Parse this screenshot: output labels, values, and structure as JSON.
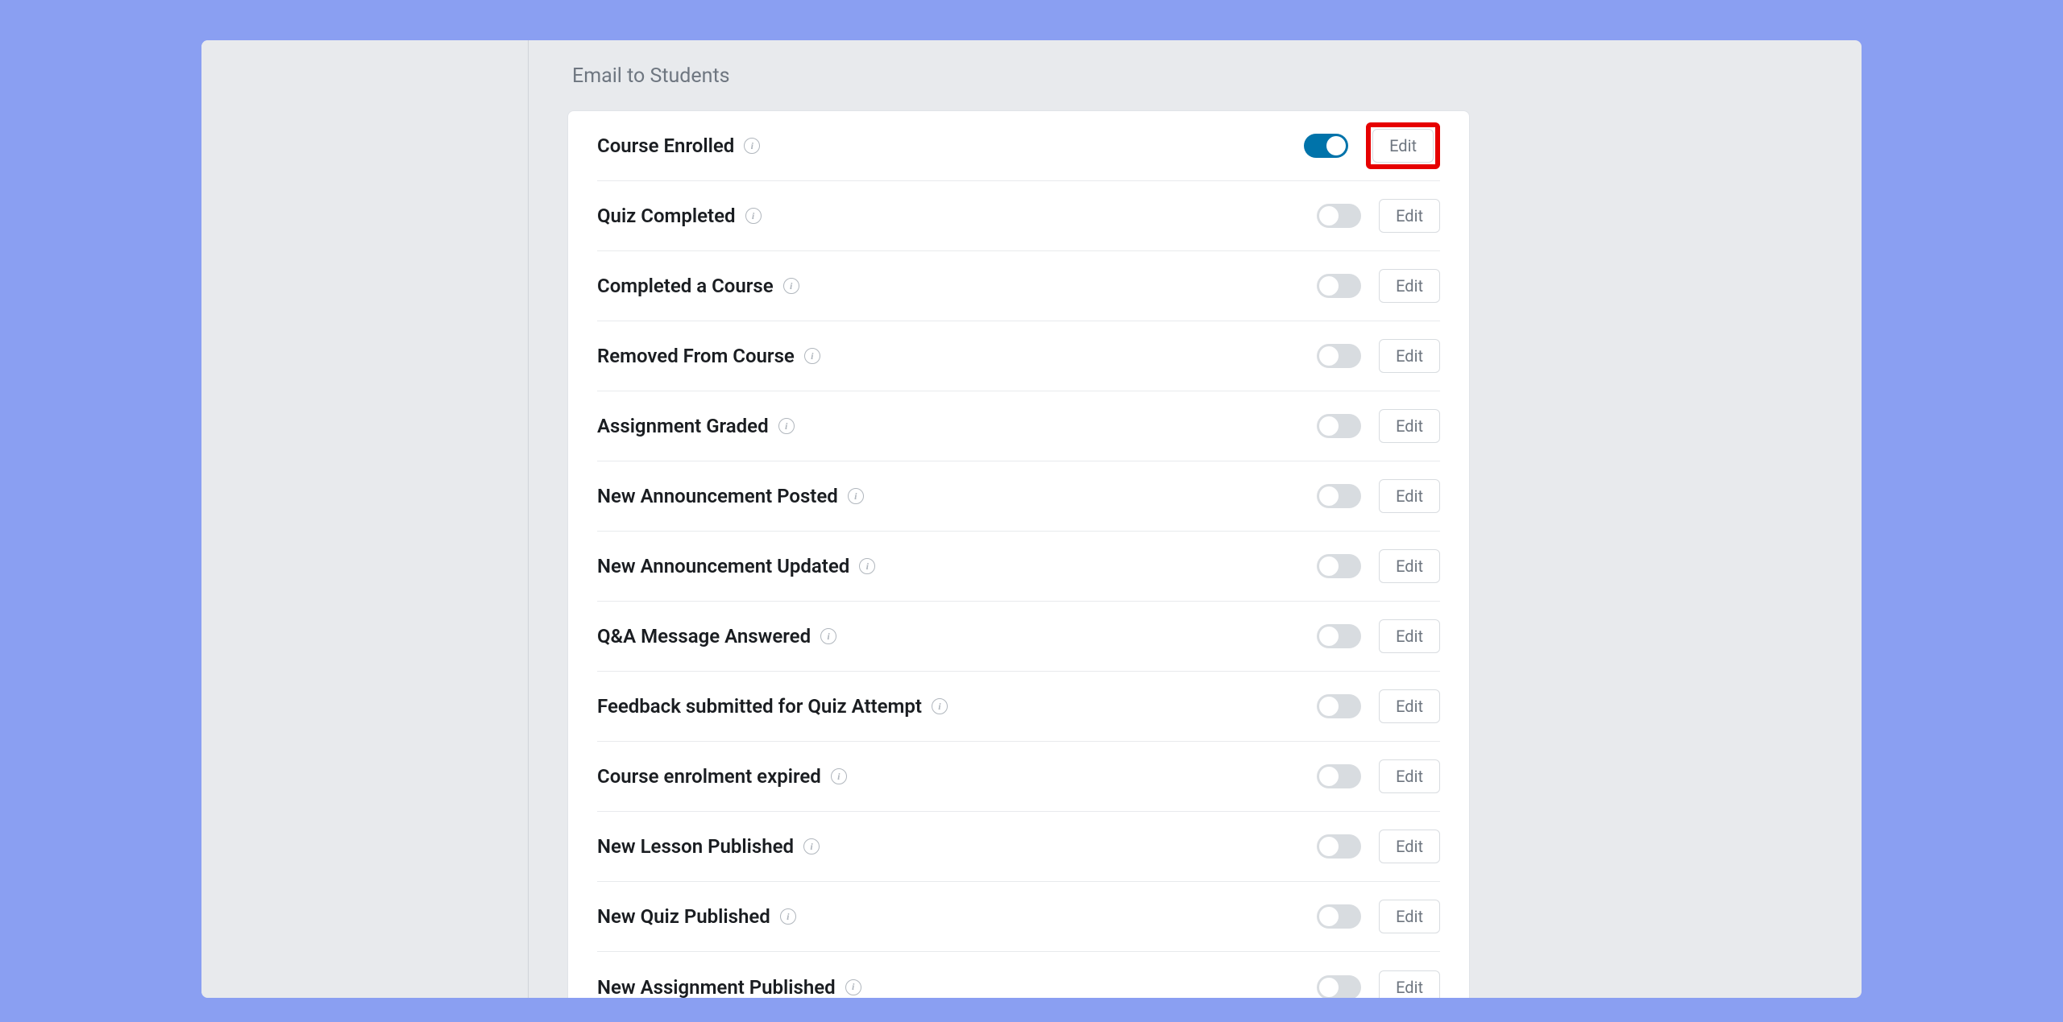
{
  "section_title": "Email to Students",
  "edit_label": "Edit",
  "rows": [
    {
      "label": "Course Enrolled",
      "enabled": true,
      "highlighted": true
    },
    {
      "label": "Quiz Completed",
      "enabled": false,
      "highlighted": false
    },
    {
      "label": "Completed a Course",
      "enabled": false,
      "highlighted": false
    },
    {
      "label": "Removed From Course",
      "enabled": false,
      "highlighted": false
    },
    {
      "label": "Assignment Graded",
      "enabled": false,
      "highlighted": false
    },
    {
      "label": "New Announcement Posted",
      "enabled": false,
      "highlighted": false
    },
    {
      "label": "New Announcement Updated",
      "enabled": false,
      "highlighted": false
    },
    {
      "label": "Q&A Message Answered",
      "enabled": false,
      "highlighted": false
    },
    {
      "label": "Feedback submitted for Quiz Attempt",
      "enabled": false,
      "highlighted": false
    },
    {
      "label": "Course enrolment expired",
      "enabled": false,
      "highlighted": false
    },
    {
      "label": "New Lesson Published",
      "enabled": false,
      "highlighted": false
    },
    {
      "label": "New Quiz Published",
      "enabled": false,
      "highlighted": false
    },
    {
      "label": "New Assignment Published",
      "enabled": false,
      "highlighted": false
    }
  ]
}
